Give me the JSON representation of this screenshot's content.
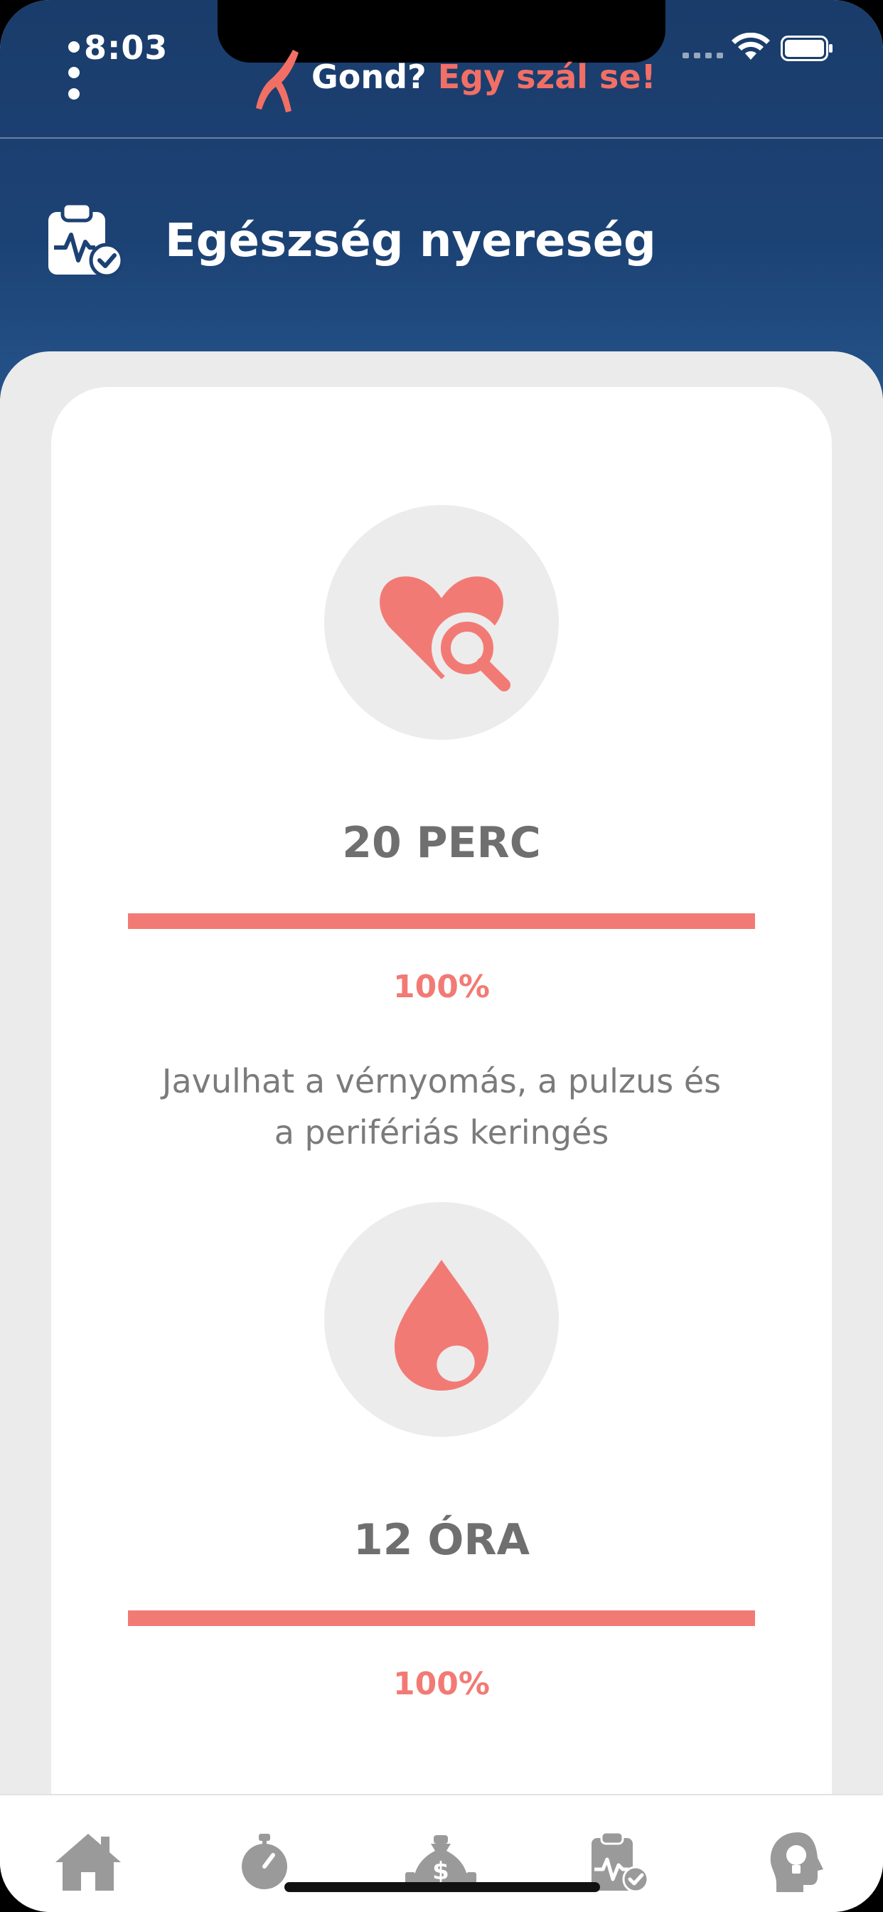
{
  "status_bar": {
    "time": "8:03"
  },
  "header": {
    "brand_part1": "Gond?",
    "brand_part2": "Egy szál se!",
    "section_title": "Egészség nyereség",
    "section_icon": "health-clipboard-check-icon"
  },
  "benefits": [
    {
      "icon": "heart-search-icon",
      "title": "20 PERC",
      "progress_percent": 100,
      "percent_label": "100%",
      "description": "Javulhat a vérnyomás, a pulzus és a perifériás keringés"
    },
    {
      "icon": "blood-drop-icon",
      "title": "12 ÓRA",
      "progress_percent": 100,
      "percent_label": "100%"
    }
  ],
  "tabbar": {
    "items": [
      {
        "icon": "home-icon"
      },
      {
        "icon": "stopwatch-icon"
      },
      {
        "icon": "money-bag-icon"
      },
      {
        "icon": "health-clipboard-icon"
      },
      {
        "icon": "lightbulb-head-icon"
      }
    ]
  },
  "colors": {
    "header_blue": "#1c4274",
    "accent": "#f27a75",
    "tab_icon": "#9a9a9a"
  }
}
